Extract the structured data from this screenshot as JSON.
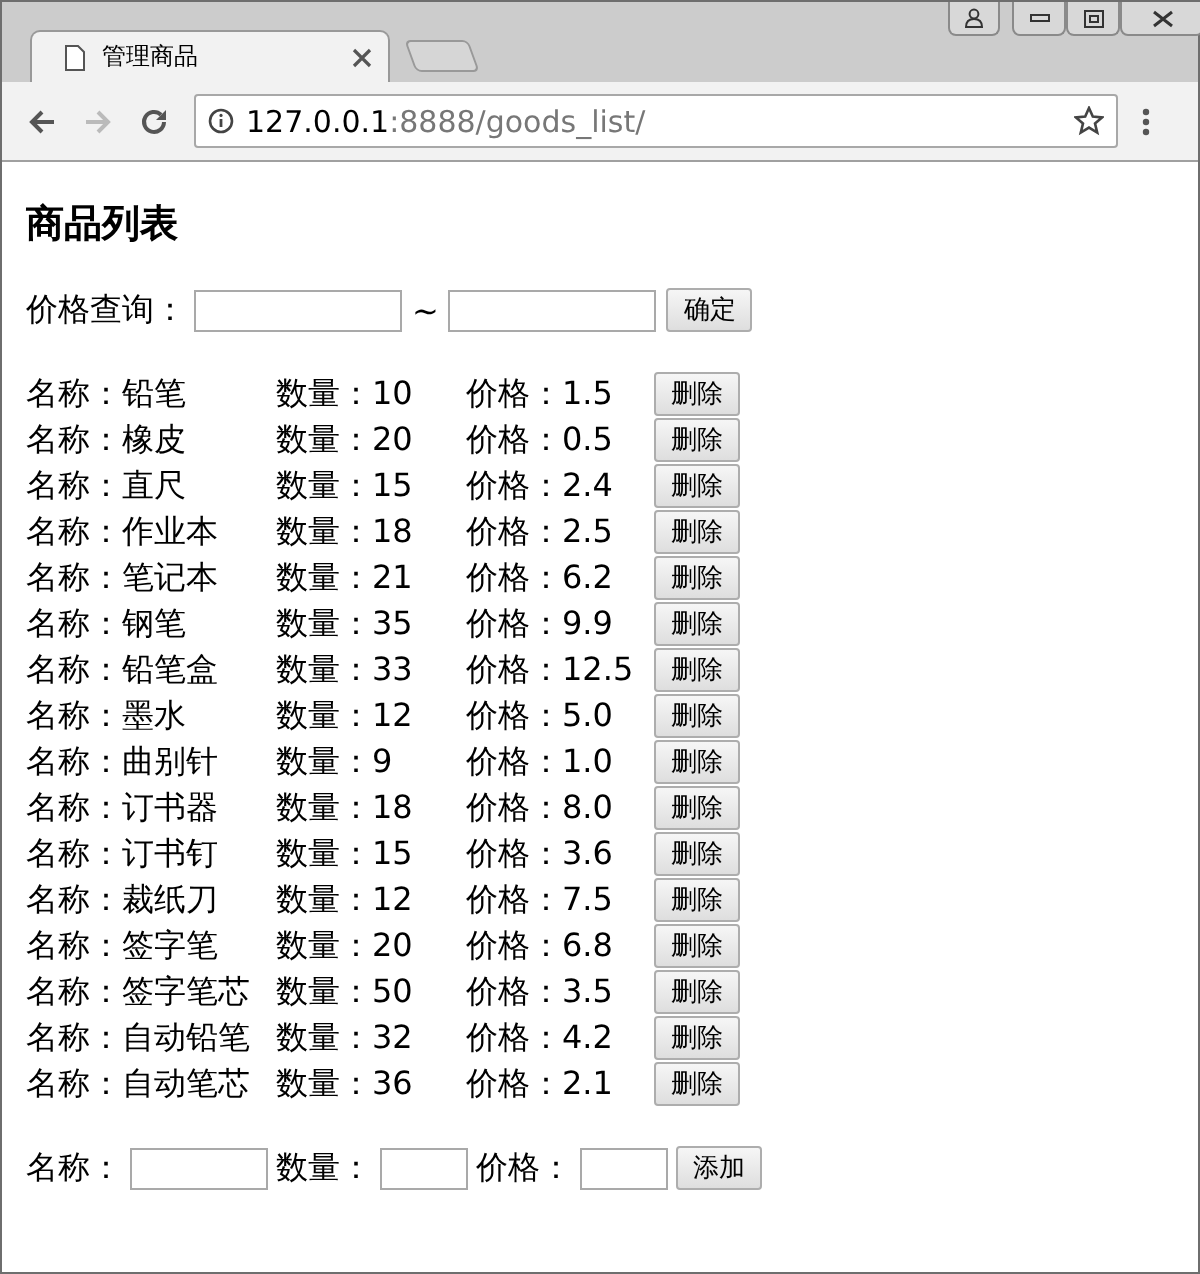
{
  "browser": {
    "tab_title": "管理商品",
    "url_host": "127.0.0.1",
    "url_rest": ":8888/goods_list/"
  },
  "heading": "商品列表",
  "price_filter": {
    "label": "价格查询：",
    "separator": "~",
    "button": "确定"
  },
  "goods": [
    {
      "name": "名称：铅笔",
      "quantity": "数量：10",
      "price": "价格：1.5",
      "button": "删除"
    },
    {
      "name": "名称：橡皮",
      "quantity": "数量：20",
      "price": "价格：0.5",
      "button": "删除"
    },
    {
      "name": "名称：直尺",
      "quantity": "数量：15",
      "price": "价格：2.4",
      "button": "删除"
    },
    {
      "name": "名称：作业本",
      "quantity": "数量：18",
      "price": "价格：2.5",
      "button": "删除"
    },
    {
      "name": "名称：笔记本",
      "quantity": "数量：21",
      "price": "价格：6.2",
      "button": "删除"
    },
    {
      "name": "名称：钢笔",
      "quantity": "数量：35",
      "price": "价格：9.9",
      "button": "删除"
    },
    {
      "name": "名称：铅笔盒",
      "quantity": "数量：33",
      "price": "价格：12.5",
      "button": "删除"
    },
    {
      "name": "名称：墨水",
      "quantity": "数量：12",
      "price": "价格：5.0",
      "button": "删除"
    },
    {
      "name": "名称：曲别针",
      "quantity": "数量：9",
      "price": "价格：1.0",
      "button": "删除"
    },
    {
      "name": "名称：订书器",
      "quantity": "数量：18",
      "price": "价格：8.0",
      "button": "删除"
    },
    {
      "name": "名称：订书钉",
      "quantity": "数量：15",
      "price": "价格：3.6",
      "button": "删除"
    },
    {
      "name": "名称：裁纸刀",
      "quantity": "数量：12",
      "price": "价格：7.5",
      "button": "删除"
    },
    {
      "name": "名称：签字笔",
      "quantity": "数量：20",
      "price": "价格：6.8",
      "button": "删除"
    },
    {
      "name": "名称：签字笔芯",
      "quantity": "数量：50",
      "price": "价格：3.5",
      "button": "删除"
    },
    {
      "name": "名称：自动铅笔",
      "quantity": "数量：32",
      "price": "价格：4.2",
      "button": "删除"
    },
    {
      "name": "名称：自动笔芯",
      "quantity": "数量：36",
      "price": "价格：2.1",
      "button": "删除"
    }
  ],
  "add_form": {
    "name_label": "名称：",
    "quantity_label": "数量：",
    "price_label": "价格：",
    "button": "添加"
  }
}
